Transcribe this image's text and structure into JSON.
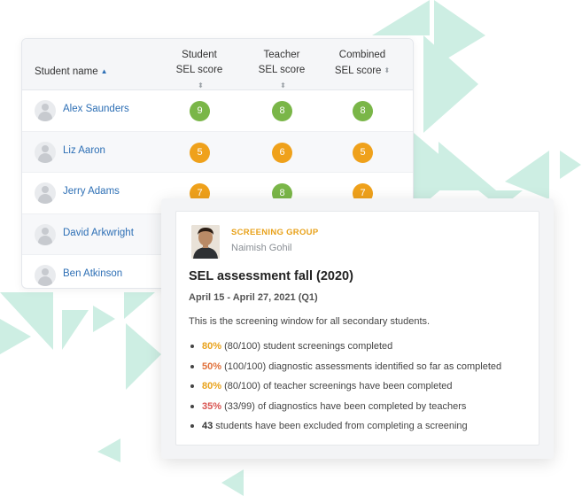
{
  "colors": {
    "link": "#2d6fb5",
    "score_high": "#7ab648",
    "score_mid": "#efa11b",
    "pct_orange": "#e8a21b",
    "pct_red": "#d9534f",
    "decor": "#cdeee3"
  },
  "table": {
    "headers": {
      "name": "Student name",
      "student_line1": "Student",
      "student_line2": "SEL score",
      "teacher_line1": "Teacher",
      "teacher_line2": "SEL score",
      "combined_line1": "Combined",
      "combined_line2": "SEL score"
    },
    "rows": [
      {
        "name": "Alex Saunders",
        "student": "9",
        "teacher": "8",
        "combined": "8"
      },
      {
        "name": "Liz Aaron",
        "student": "5",
        "teacher": "6",
        "combined": "5"
      },
      {
        "name": "Jerry Adams",
        "student": "7",
        "teacher": "8",
        "combined": "7"
      },
      {
        "name": "David Arkwright",
        "student": "",
        "teacher": "",
        "combined": ""
      },
      {
        "name": "Ben Atkinson",
        "student": "",
        "teacher": "",
        "combined": ""
      }
    ]
  },
  "popup": {
    "group_label": "SCREENING GROUP",
    "person": "Naimish Gohil",
    "title": "SEL assessment fall (2020)",
    "date_range": "April 15 - April 27, 2021 (Q1)",
    "description": "This is the screening window for all secondary students.",
    "items": [
      {
        "pct": "80%",
        "rest": " (80/100) student screenings completed",
        "color": "#e8a21b"
      },
      {
        "pct": "50%",
        "rest": " (100/100) diagnostic assessments identified so far as completed",
        "color": "#e0703a"
      },
      {
        "pct": "80%",
        "rest": " (80/100) of teacher screenings have been completed",
        "color": "#e8a21b"
      },
      {
        "pct": "35%",
        "rest": " (33/99) of diagnostics have been completed by teachers",
        "color": "#d9534f"
      },
      {
        "pct": "43",
        "rest": " students have been excluded from completing a screening",
        "color": "#333333"
      }
    ]
  }
}
